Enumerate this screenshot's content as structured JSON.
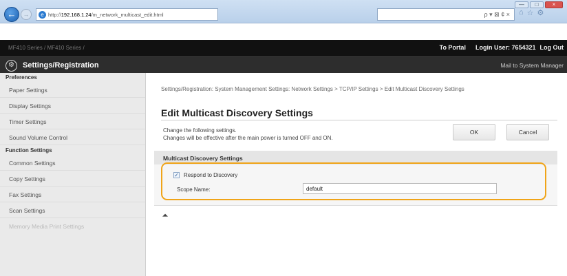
{
  "browser": {
    "url_prefix": "http://",
    "url_host": "192.168.1.24",
    "url_path": "/m_network_multicast_edit.html",
    "search_glyphs": "ρ ▾ ⊠ ¢ ×",
    "window_controls": [
      "—",
      "□",
      "×"
    ],
    "toolbar_icons": [
      "⌂",
      "☆",
      "⚙"
    ]
  },
  "header": {
    "printer_name": "MF410 Series / MF410 Series /",
    "to_portal": "To Portal",
    "login_user": "Login User:  7654321",
    "log_out": "Log Out",
    "app_title": "Settings/Registration",
    "mail_link": "Mail to System Manager"
  },
  "sidebar": {
    "preferences_heading": "Preferences",
    "preferences_items": [
      "Paper Settings",
      "Display Settings",
      "Timer Settings",
      "Sound Volume Control"
    ],
    "function_heading": "Function Settings",
    "function_items": [
      "Common Settings",
      "Copy Settings",
      "Fax Settings",
      "Scan Settings",
      "Memory Media Print Settings"
    ]
  },
  "main": {
    "breadcrumb": "Settings/Registration: System Management Settings: Network Settings > TCP/IP Settings > Edit Multicast Discovery Settings",
    "title": "Edit Multicast Discovery Settings",
    "desc_line1": "Change the following settings.",
    "desc_line2": "Changes will be effective after the main power is turned OFF and ON.",
    "ok_label": "OK",
    "cancel_label": "Cancel",
    "section_title": "Multicast Discovery Settings",
    "respond_label": "Respond to Discovery",
    "respond_checked": true,
    "scope_label": "Scope Name:",
    "scope_value": "default",
    "top_link": "⏶"
  },
  "colors": {
    "highlight": "#f0a418",
    "header_dark": "#111111",
    "sidebar_bg": "#eaeaea"
  }
}
